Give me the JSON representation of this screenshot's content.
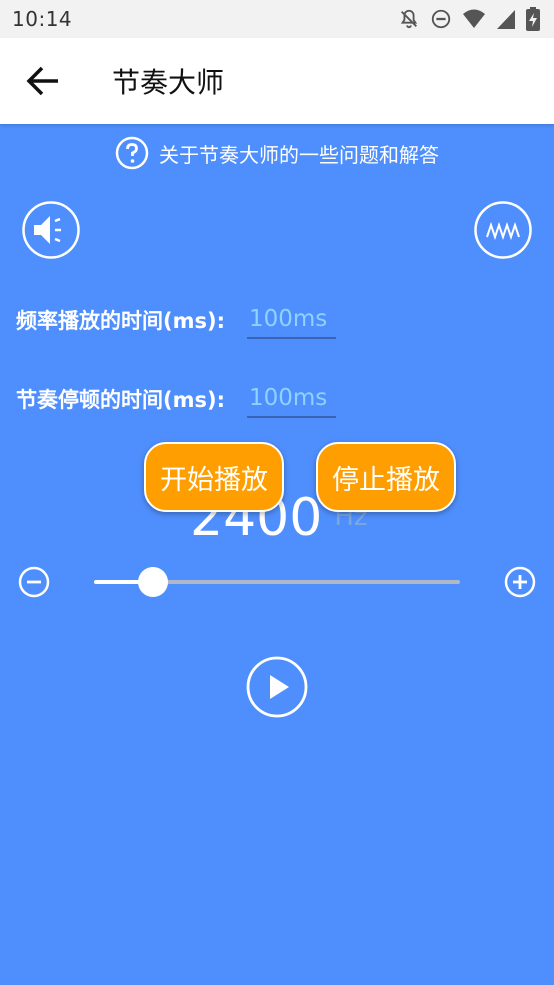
{
  "status_bar": {
    "time": "10:14",
    "icons": [
      "notifications-off-icon",
      "do-not-disturb-icon",
      "wifi-icon",
      "signal-icon",
      "battery-charging-icon"
    ]
  },
  "app_bar": {
    "back_icon": "arrow-left-icon",
    "title": "节奏大师"
  },
  "faq": {
    "icon": "help-circle-icon",
    "text": "关于节奏大师的一些问题和解答"
  },
  "controls": {
    "speaker_icon": "speaker-icon",
    "waveform_icon": "waveform-icon"
  },
  "fields": {
    "play_time_label": "频率播放的时间(ms):",
    "play_time_placeholder": "100ms",
    "pause_time_label": "节奏停顿的时间(ms):",
    "pause_time_placeholder": "100ms"
  },
  "buttons": {
    "start": "开始播放",
    "stop": "停止播放"
  },
  "frequency": {
    "value": "2400",
    "unit": "Hz"
  },
  "slider": {
    "fraction": 0.16,
    "minus_icon": "minus-circle-icon",
    "plus_icon": "plus-circle-icon"
  },
  "play": {
    "icon": "play-circle-icon"
  },
  "colors": {
    "background": "#4f8ffd",
    "accent_button": "#ff9e00",
    "input_text": "#8fd1ff"
  }
}
